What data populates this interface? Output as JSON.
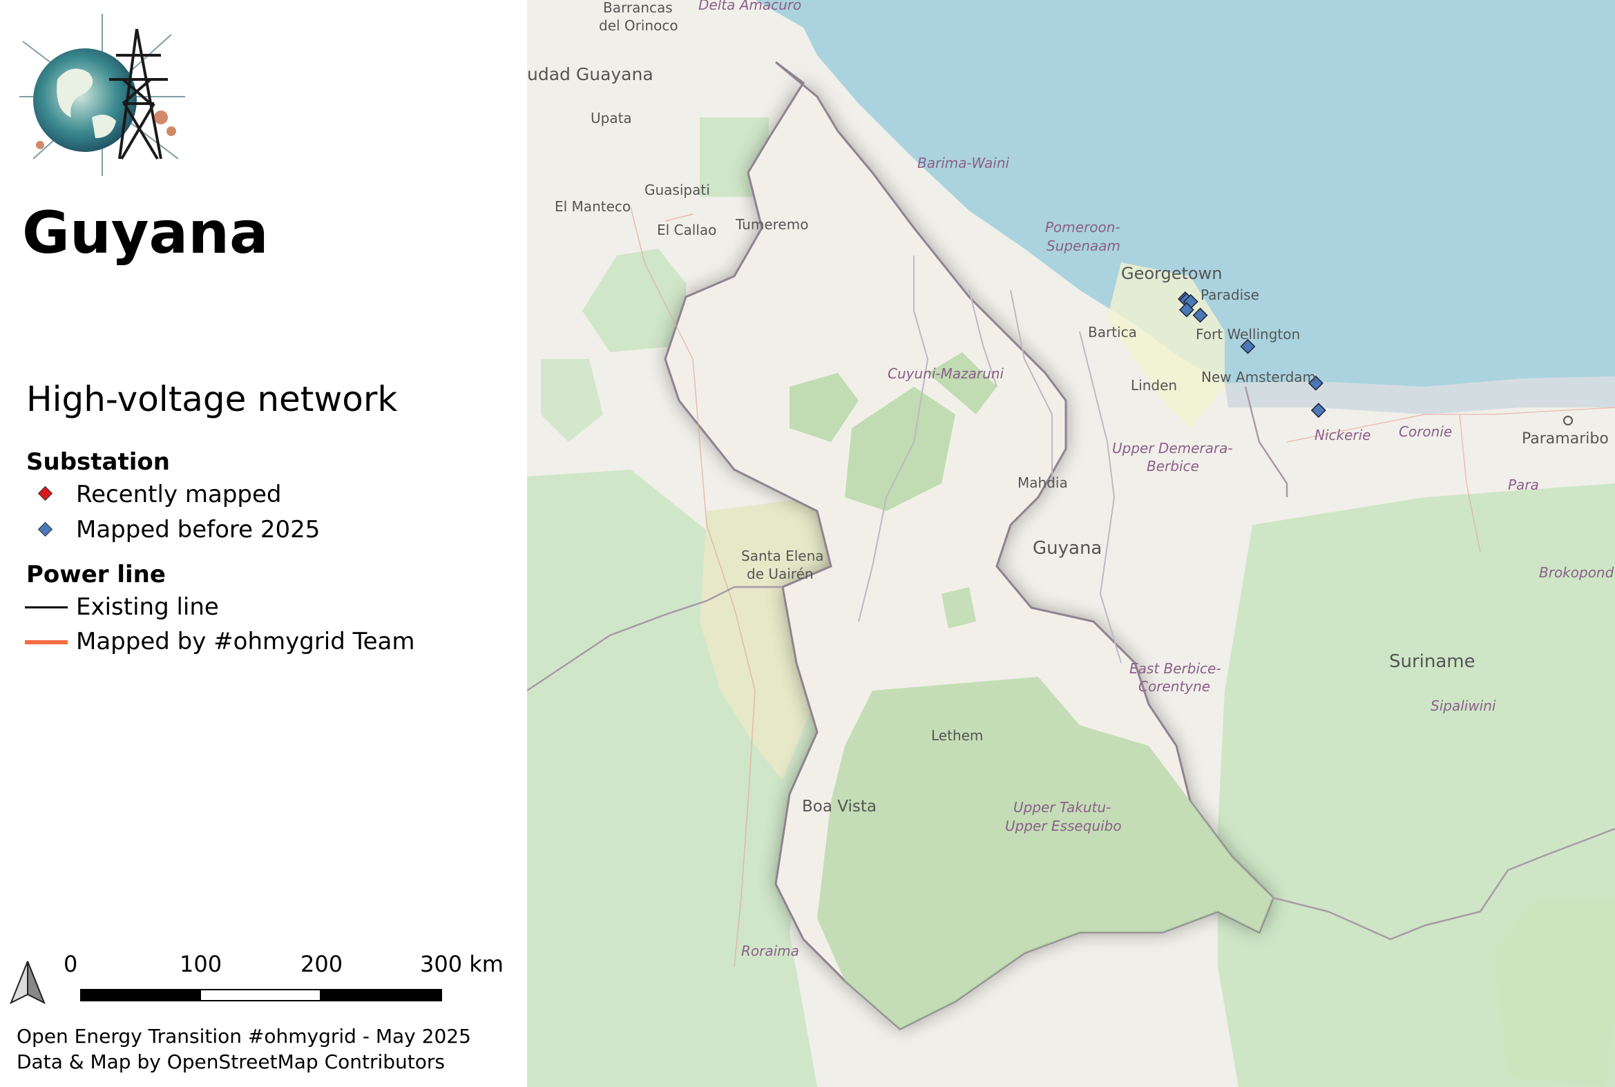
{
  "title": "Guyana",
  "legend": {
    "heading": "High-voltage network",
    "substation": {
      "title": "Substation",
      "items": [
        {
          "label": "Recently mapped",
          "color": "#d7191c"
        },
        {
          "label": "Mapped before 2025",
          "color": "#4a78b8"
        }
      ]
    },
    "powerline": {
      "title": "Power line",
      "items": [
        {
          "label": "Existing line",
          "color": "#000000"
        },
        {
          "label": "Mapped by #ohmygrid Team",
          "color": "#f46d43"
        }
      ]
    }
  },
  "scalebar": {
    "ticks": [
      "0",
      "100",
      "200",
      "300 km"
    ]
  },
  "credits": {
    "line1": "Open Energy Transition #ohmygrid - May 2025",
    "line2": "Data & Map by OpenStreetMap Contributors"
  },
  "icons": {
    "logo": "globe-pylon-logo-icon",
    "north": "north-arrow-icon"
  },
  "map": {
    "place_labels": {
      "barrancas": "Barrancas",
      "del_orinoco": "del Orinoco",
      "delta_amacuro": "Delta Amacuro",
      "ciudad_guayana": "udad Guayana",
      "upata": "Upata",
      "guasipati": "Guasipati",
      "el_manteco": "El Manteco",
      "el_callao": "El Callao",
      "tumeremo": "Tumeremo",
      "georgetown": "Georgetown",
      "paradise": "Paradise",
      "bartica": "Bartica",
      "fort_wellington": "Fort Wellington",
      "linden": "Linden",
      "new_amsterdam": "New Amsterdam",
      "mahdia": "Mahdia",
      "guyana": "Guyana",
      "santa_elena": "Santa Elena",
      "de_uairen": "de Uairén",
      "lethem": "Lethem",
      "boa_vista": "Boa Vista",
      "paramaribo": "Paramaribo",
      "suriname": "Suriname"
    },
    "region_labels": {
      "barima_waini": "Barima-Waini",
      "pomeroon": "Pomeroon-",
      "supenaam": "Supenaam",
      "cuyuni": "Cuyuni-Mazaruni",
      "upper_demerara": "Upper Demerara-",
      "berbice": "Berbice",
      "east_berbice": "East Berbice-",
      "corentyne": "Corentyne",
      "upper_takutu": "Upper Takutu-",
      "upper_essequibo": "Upper Essequibo",
      "nickerie": "Nickerie",
      "coronie": "Coronie",
      "para": "Para",
      "brokopondo": "Brokopond",
      "sipaliwini": "Sipaliwini",
      "roraima": "Roraima"
    },
    "substations": [
      {
        "lon": -58.16,
        "lat": 6.8,
        "status": "Mapped before 2025"
      },
      {
        "lon": -58.15,
        "lat": 6.79,
        "status": "Mapped before 2025"
      },
      {
        "lon": -58.12,
        "lat": 6.78,
        "status": "Mapped before 2025"
      },
      {
        "lon": -58.15,
        "lat": 6.72,
        "status": "Mapped before 2025"
      },
      {
        "lon": -58.05,
        "lat": 6.68,
        "status": "Mapped before 2025"
      },
      {
        "lon": -57.7,
        "lat": 6.45,
        "status": "Mapped before 2025"
      },
      {
        "lon": -57.2,
        "lat": 6.18,
        "status": "Mapped before 2025"
      },
      {
        "lon": -57.18,
        "lat": 5.98,
        "status": "Mapped before 2025"
      }
    ]
  }
}
